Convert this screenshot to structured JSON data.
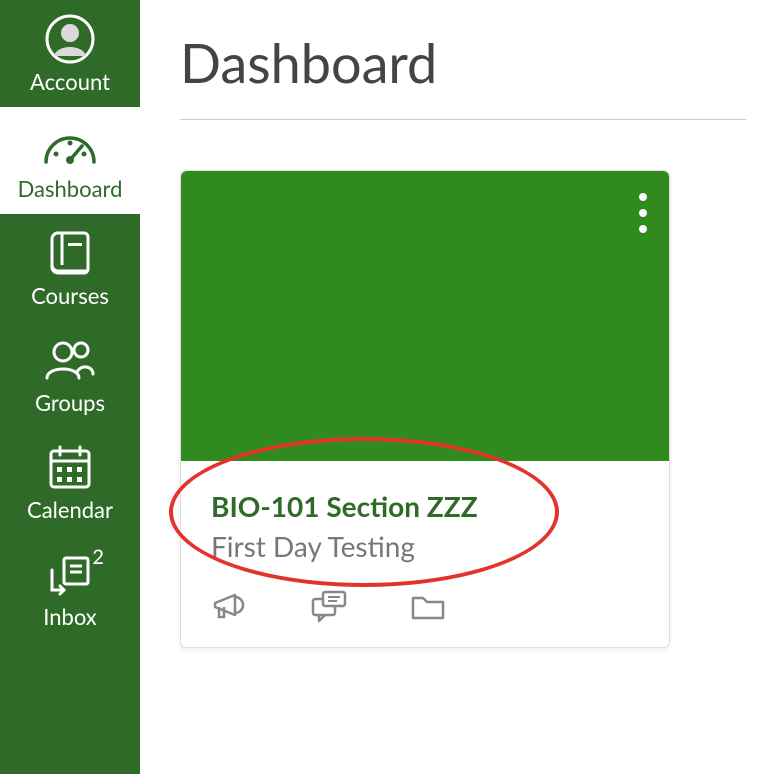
{
  "sidebar": {
    "items": [
      {
        "label": "Account"
      },
      {
        "label": "Dashboard"
      },
      {
        "label": "Courses"
      },
      {
        "label": "Groups"
      },
      {
        "label": "Calendar"
      },
      {
        "label": "Inbox",
        "badge": "2"
      }
    ]
  },
  "page": {
    "title": "Dashboard"
  },
  "card": {
    "title": "BIO-101 Section ZZZ",
    "subtitle": "First Day Testing"
  }
}
